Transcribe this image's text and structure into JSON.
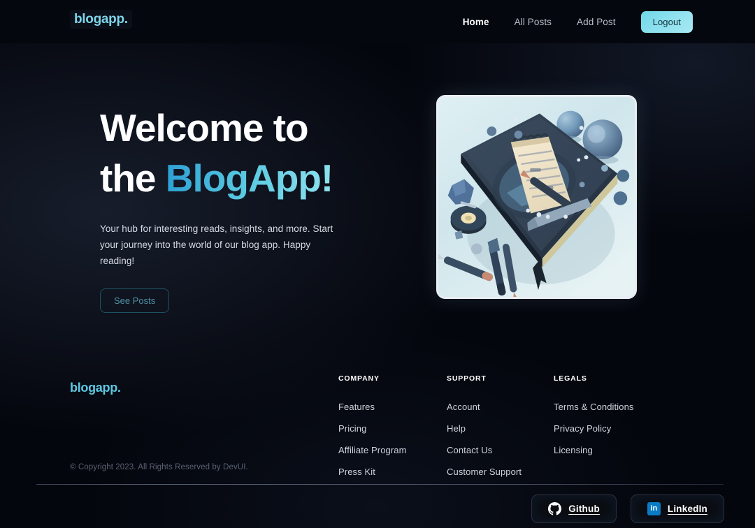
{
  "navbar": {
    "logo": "blogapp.",
    "links": [
      {
        "label": "Home",
        "active": true
      },
      {
        "label": "All Posts",
        "active": false
      },
      {
        "label": "Add Post",
        "active": false
      }
    ],
    "logout_label": "Logout"
  },
  "hero": {
    "title_line1": "Welcome to",
    "title_line2_prefix": "the ",
    "title_line2_brand": "BlogApp!",
    "subtitle": "Your hub for interesting reads, insights, and more. Start your journey into the world of our blog app. Happy reading!",
    "cta_label": "See Posts",
    "image_alt": "3D illustration of a dark navy notebook with a spiral notepad, pen and scattered blue objects"
  },
  "footer": {
    "logo": "blogapp.",
    "copyright": "© Copyright 2023. All Rights Reserved by DevUI.",
    "columns": [
      {
        "title": "COMPANY",
        "links": [
          "Features",
          "Pricing",
          "Affiliate Program",
          "Press Kit"
        ]
      },
      {
        "title": "SUPPORT",
        "links": [
          "Account",
          "Help",
          "Contact Us",
          "Customer Support"
        ]
      },
      {
        "title": "LEGALS",
        "links": [
          "Terms & Conditions",
          "Privacy Policy",
          "Licensing"
        ]
      }
    ],
    "socials": [
      {
        "label": "Github",
        "icon": "github-icon"
      },
      {
        "label": "LinkedIn",
        "icon": "linkedin-icon",
        "glyph": "in"
      }
    ]
  },
  "colors": {
    "accent_cyan": "#7fd6ea",
    "brand_gradient_start": "#2d9fd4",
    "brand_gradient_end": "#8fe3ef",
    "page_bg": "#04060d",
    "navbar_bg": "#04070e",
    "linkedin_blue": "#0a7ac4"
  }
}
